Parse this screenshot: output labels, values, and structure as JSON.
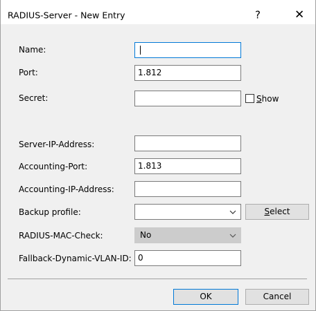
{
  "window": {
    "title": "RADIUS-Server - New Entry",
    "help_label": "?",
    "close_label": "✕"
  },
  "form": {
    "name": {
      "label": "Name:",
      "value": ""
    },
    "port": {
      "label": "Port:",
      "value": "1.812"
    },
    "secret": {
      "label": "Secret:",
      "value": ""
    },
    "show": {
      "label": "Show",
      "accesskey": "S",
      "checked": false
    },
    "server_ip": {
      "label": "Server-IP-Address:",
      "value": ""
    },
    "accounting_port": {
      "label": "Accounting-Port:",
      "value": "1.813"
    },
    "accounting_ip": {
      "label": "Accounting-IP-Address:",
      "value": ""
    },
    "backup_profile": {
      "label": "Backup profile:",
      "value": ""
    },
    "select_button": {
      "label": "Select",
      "accesskey": "S"
    },
    "radius_mac_check": {
      "label": "RADIUS-MAC-Check:",
      "value": "No",
      "disabled": true
    },
    "fallback_vlan": {
      "label": "Fallback-Dynamic-VLAN-ID:",
      "value": "0"
    }
  },
  "buttons": {
    "ok": "OK",
    "cancel": "Cancel"
  },
  "colors": {
    "dialog_bg": "#f0f0f0",
    "titlebar_bg": "#ffffff",
    "focus_border": "#0078d7",
    "disabled_bg": "#cccccc"
  }
}
